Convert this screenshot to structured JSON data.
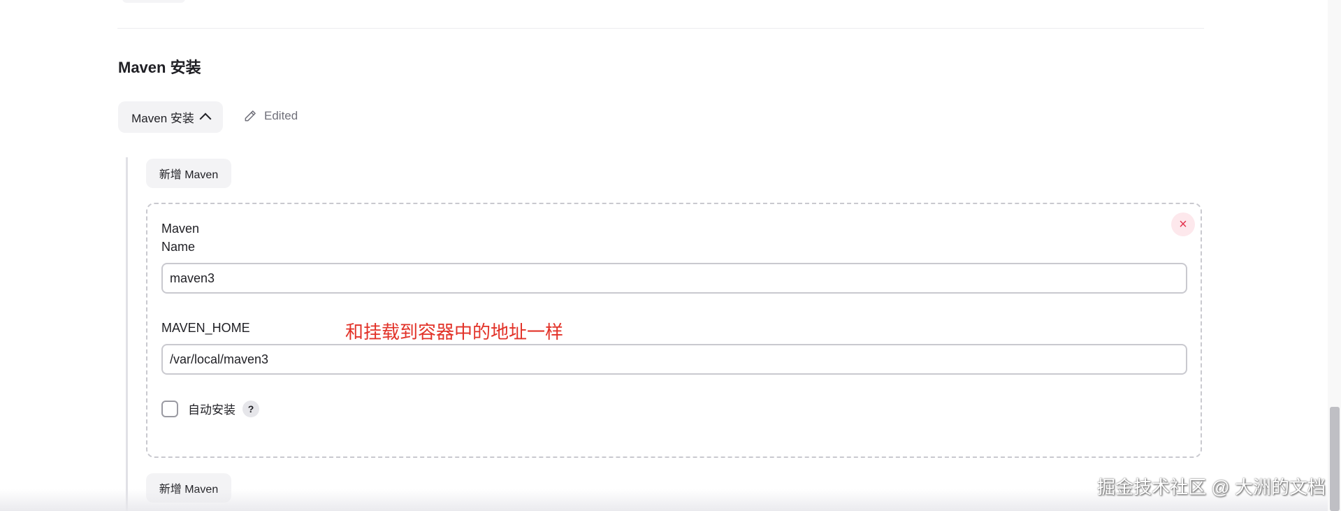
{
  "section": {
    "title": "Maven 安装",
    "toggle_label": "Maven 安装",
    "edited_label": "Edited"
  },
  "add_button_label": "新增 Maven",
  "maven_entry": {
    "name_label": "Maven Name",
    "name_value": "maven3",
    "home_label": "MAVEN_HOME",
    "home_value": "/var/local/maven3",
    "auto_install_label": "自动安装",
    "auto_install_checked": false,
    "help_symbol": "?",
    "close_symbol": "×"
  },
  "annotation": {
    "text": "和挂载到容器中的地址一样",
    "color": "#e23228"
  },
  "watermark": "掘金技术社区 @ 大洲的文档",
  "icons": {
    "toggle": "chevron-up-icon",
    "edited": "pencil-icon",
    "close": "close-icon",
    "help": "help-icon"
  }
}
